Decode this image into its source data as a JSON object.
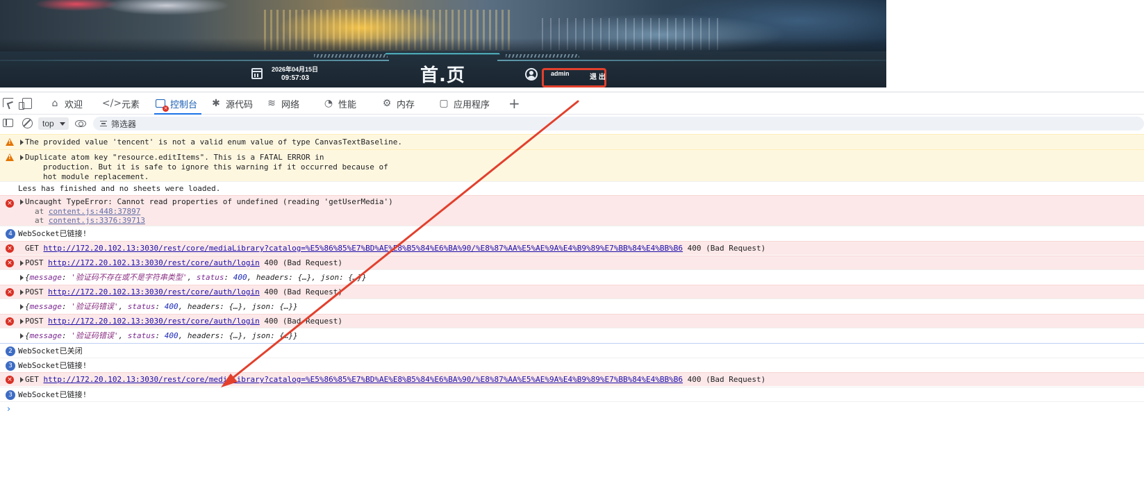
{
  "banner": {
    "date": "2026年04月15日",
    "time": "09:57:03",
    "title": "首.页",
    "username": "admin",
    "logout_label": "退 出"
  },
  "devtools": {
    "tabs": [
      {
        "label": "欢迎",
        "icon": "home-icon"
      },
      {
        "label": "元素",
        "icon": "code-icon"
      },
      {
        "label": "控制台",
        "icon": "console-icon",
        "active": true
      },
      {
        "label": "源代码",
        "icon": "bug-icon"
      },
      {
        "label": "网络",
        "icon": "wifi-icon"
      },
      {
        "label": "性能",
        "icon": "gauge-icon"
      },
      {
        "label": "内存",
        "icon": "chip-icon"
      },
      {
        "label": "应用程序",
        "icon": "app-window-icon"
      }
    ],
    "context": "top",
    "filter_placeholder": "筛选器"
  },
  "console": {
    "warn1": "The provided value 'tencent' is not a valid enum value of type CanvasTextBaseline.",
    "warn2_l1": "Duplicate atom key \"resource.editItems\". This is a FATAL ERROR in",
    "warn2_l2": "production. But it is safe to ignore this warning if it occurred because of",
    "warn2_l3": "hot module replacement.",
    "info_less": "Less has finished and no sheets were loaded.",
    "err1": "Uncaught TypeError: Cannot read properties of undefined (reading 'getUserMedia')",
    "err1_at_prefix": "at ",
    "err1_at1": "content.js:448:37897",
    "err1_at2": "content.js:3376:39713",
    "ws_count1": "4",
    "ws_connected": "WebSocket已链接!",
    "get_method": "GET",
    "post_method": "POST",
    "media_url": "http://172.20.102.13:3030/rest/core/mediaLibrary?catalog=%E5%86%85%E7%BD%AE%E8%B5%84%E6%BA%90/%E8%87%AA%E5%AE%9A%E4%B9%89%E7%BB%84%E4%BB%B6",
    "login_url": "http://172.20.102.13:3030/rest/core/auth/login",
    "bad_request": "400 (Bad Request)",
    "obj1_msg": "'验证码不存在或不是字符串类型'",
    "obj2_msg": "'验证码错误'",
    "obj3_msg": "'验证码错误'",
    "obj_key_message": "message",
    "obj_key_status": "status",
    "obj_status_val": "400",
    "obj_tail": "headers: {…}, json: {…}}",
    "ws_count2": "2",
    "ws_closed": "WebSocket已关闭",
    "ws_count3": "3",
    "ws_count4": "3"
  }
}
